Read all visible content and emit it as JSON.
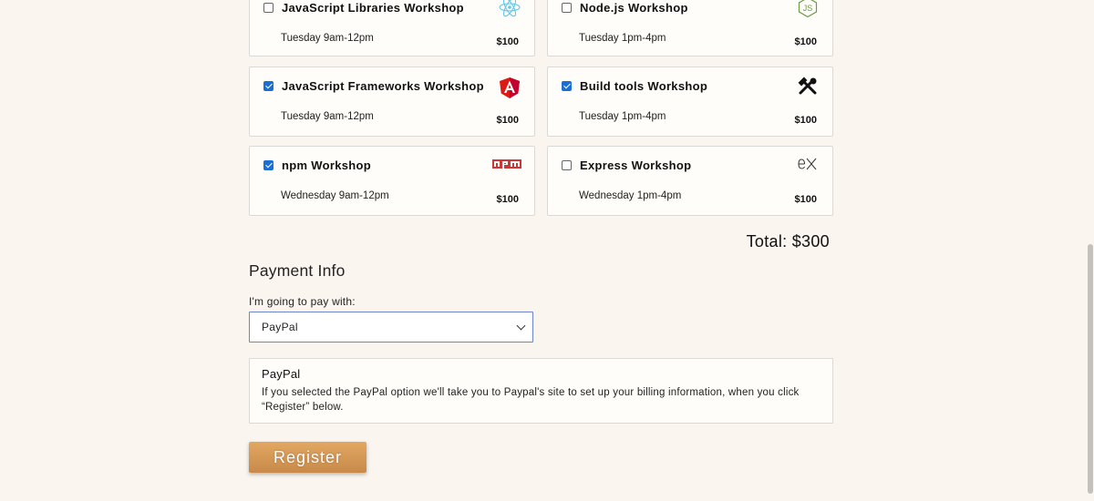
{
  "workshops": [
    {
      "title": "JavaScript Libraries Workshop",
      "time": "Tuesday 9am-12pm",
      "price": "$100",
      "checked": false,
      "icon": "react-icon"
    },
    {
      "title": "Node.js Workshop",
      "time": "Tuesday 1pm-4pm",
      "price": "$100",
      "checked": false,
      "icon": "nodejs-icon"
    },
    {
      "title": "JavaScript Frameworks Workshop",
      "time": "Tuesday 9am-12pm",
      "price": "$100",
      "checked": true,
      "icon": "angular-icon"
    },
    {
      "title": "Build tools Workshop",
      "time": "Tuesday 1pm-4pm",
      "price": "$100",
      "checked": true,
      "icon": "tools-icon"
    },
    {
      "title": "npm Workshop",
      "time": "Wednesday 9am-12pm",
      "price": "$100",
      "checked": true,
      "icon": "npm-icon"
    },
    {
      "title": "Express Workshop",
      "time": "Wednesday 1pm-4pm",
      "price": "$100",
      "checked": false,
      "icon": "express-icon"
    }
  ],
  "total": "Total: $300",
  "payment": {
    "heading": "Payment Info",
    "label": "I'm going to pay with:",
    "selected": "PayPal",
    "info_title": "PayPal",
    "info_text": "If you selected the PayPal option we'll take you to Paypal's site to set up your billing information, when you click “Register” below."
  },
  "register_label": "Register",
  "colors": {
    "accent": "#1a6fd6",
    "button": "#d69a56",
    "background": "#faf5ef"
  }
}
